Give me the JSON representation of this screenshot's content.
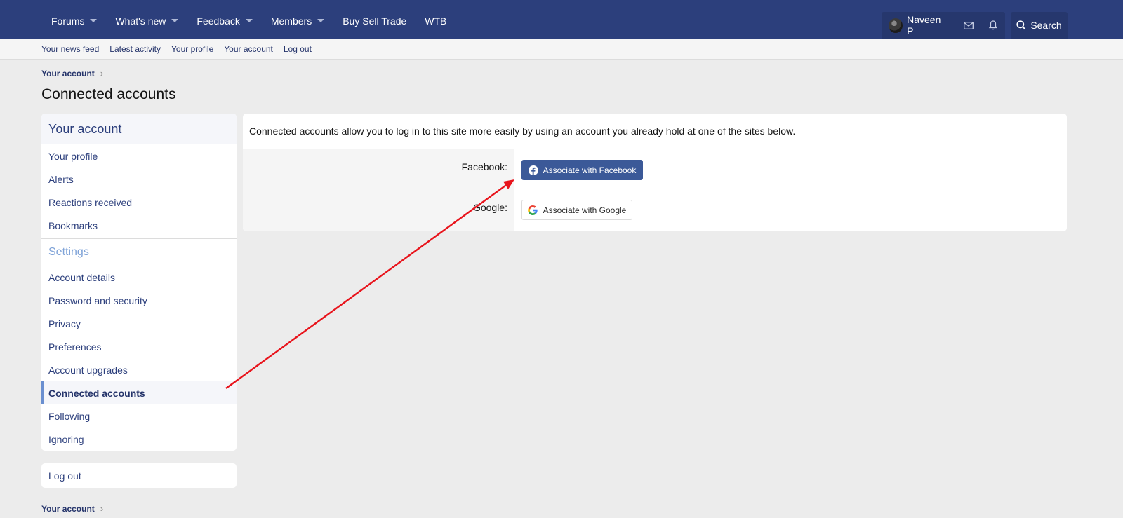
{
  "topnav": {
    "items": [
      {
        "label": "Forums",
        "caret": true
      },
      {
        "label": "What's new",
        "caret": true
      },
      {
        "label": "Feedback",
        "caret": true
      },
      {
        "label": "Members",
        "caret": true
      },
      {
        "label": "Buy Sell Trade",
        "caret": false
      },
      {
        "label": "WTB",
        "caret": false
      }
    ],
    "user_name": "Naveen P",
    "search_label": "Search"
  },
  "subnav": {
    "links": [
      "Your news feed",
      "Latest activity",
      "Your profile",
      "Your account",
      "Log out"
    ]
  },
  "breadcrumb": {
    "label": "Your account"
  },
  "page_title": "Connected accounts",
  "sidebar": {
    "header": "Your account",
    "items_top": [
      "Your profile",
      "Alerts",
      "Reactions received",
      "Bookmarks"
    ],
    "settings_label": "Settings",
    "items_settings": [
      "Account details",
      "Password and security",
      "Privacy",
      "Preferences",
      "Account upgrades",
      "Connected accounts",
      "Following",
      "Ignoring"
    ],
    "active_item": "Connected accounts",
    "logout_label": "Log out"
  },
  "main": {
    "intro": "Connected accounts allow you to log in to this site more easily by using an account you already hold at one of the sites below.",
    "facebook_label": "Facebook:",
    "facebook_button": "Associate with Facebook",
    "google_label": "Google:",
    "google_button": "Associate with Google"
  },
  "footer_breadcrumb": {
    "label": "Your account"
  },
  "colors": {
    "header_bg": "#2c3f7c",
    "link": "#2c3f7c",
    "facebook": "#3b5998",
    "annotation_arrow": "#e8141c"
  }
}
